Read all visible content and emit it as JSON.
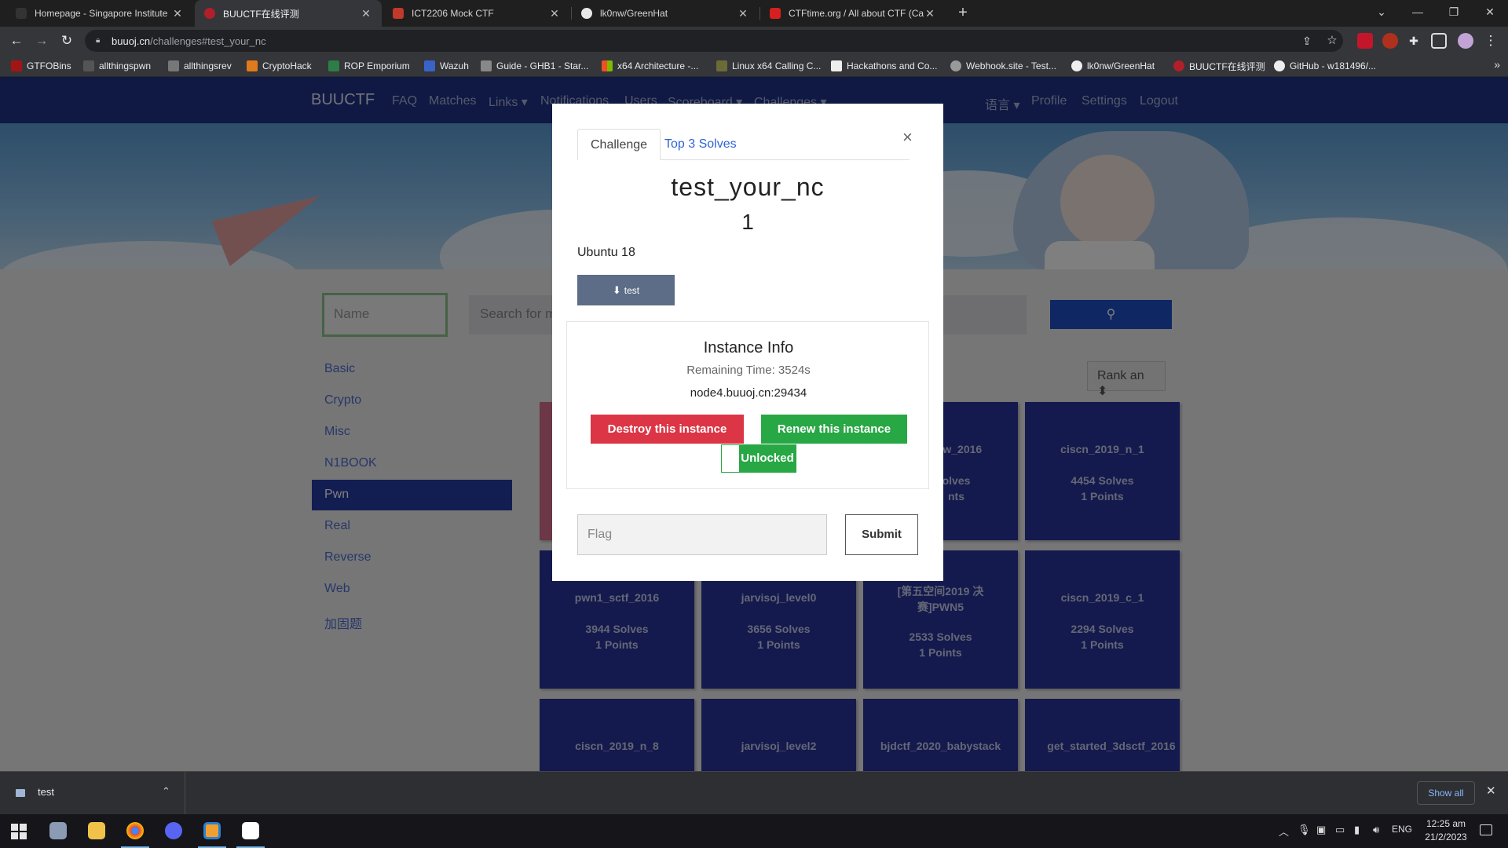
{
  "browser": {
    "tabs": [
      {
        "label": "Homepage - Singapore Institute",
        "active": false
      },
      {
        "label": "BUUCTF在线评测",
        "active": true
      },
      {
        "label": "ICT2206 Mock CTF",
        "active": false
      },
      {
        "label": "lk0nw/GreenHat",
        "active": false
      },
      {
        "label": "CTFtime.org / All about CTF (Cap",
        "active": false
      }
    ],
    "url_host": "buuoj.cn",
    "url_path": "/challenges#test_your_nc",
    "bookmarks": [
      "GTFOBins",
      "allthingspwn",
      "allthingsrev",
      "CryptoHack",
      "ROP Emporium",
      "Wazuh",
      "Guide - GHB1 - Star...",
      "x64 Architecture -...",
      "Linux x64 Calling C...",
      "Hackathons and Co...",
      "Webhook.site - Test...",
      "lk0nw/GreenHat",
      "BUUCTF在线评测",
      "GitHub - w181496/..."
    ],
    "bookmarks_more": "»"
  },
  "site": {
    "brand": "BUUCTF",
    "nav_left": [
      "FAQ",
      "Matches",
      "Links ▾",
      "Notifications",
      "Users",
      "Scoreboard ▾",
      "Challenges ▾"
    ],
    "nav_right": [
      "语言 ▾",
      "Profile",
      "Settings",
      "Logout"
    ],
    "name_placeholder": "Name",
    "search_placeholder": "Search for m",
    "categories": [
      "Basic",
      "Crypto",
      "Misc",
      "N1BOOK",
      "Pwn",
      "Real",
      "Reverse",
      "Web",
      "加固题"
    ],
    "active_category": "Pwn",
    "rank_select": "Rank an ⬍",
    "cards": [
      {
        "name": "saw_2016",
        "solves": "olves",
        "points": "nts"
      },
      {
        "name": "ciscn_2019_n_1",
        "solves": "4454 Solves",
        "points": "1 Points"
      },
      {
        "name": "pwn1_sctf_2016",
        "solves": "3944 Solves",
        "points": "1 Points"
      },
      {
        "name": "jarvisoj_level0",
        "solves": "3656 Solves",
        "points": "1 Points"
      },
      {
        "name": "[第五空间2019 决赛]PWN5",
        "solves": "2533 Solves",
        "points": "1 Points"
      },
      {
        "name": "ciscn_2019_c_1",
        "solves": "2294 Solves",
        "points": "1 Points"
      },
      {
        "name": "ciscn_2019_n_8",
        "solves": "",
        "points": ""
      },
      {
        "name": "jarvisoj_level2",
        "solves": "",
        "points": ""
      },
      {
        "name": "bjdctf_2020_babystack",
        "solves": "",
        "points": ""
      },
      {
        "name": "get_started_3dsctf_2016",
        "solves": "",
        "points": ""
      }
    ]
  },
  "modal": {
    "tabs": [
      "Challenge",
      "Top 3 Solves"
    ],
    "close": "×",
    "title": "test_your_nc",
    "value": "1",
    "description": "Ubuntu 18",
    "download_label": "test",
    "instance": {
      "title": "Instance Info",
      "remaining": "Remaining Time: 3524s",
      "host": "node4.buuoj.cn:29434",
      "destroy_label": "Destroy this instance",
      "renew_label": "Renew this instance",
      "unlocked_label": "Unlocked"
    },
    "flag_placeholder": "Flag",
    "submit_label": "Submit"
  },
  "downloads": {
    "file": "test",
    "show_all": "Show all",
    "close": "✕"
  },
  "taskbar": {
    "lang": "ENG",
    "time": "12:25 am",
    "date": "21/2/2023"
  },
  "colors": {
    "nav_bg": "#1f3388",
    "card_bg": "#28359a",
    "danger": "#dc3545",
    "success": "#28a745",
    "link": "#2f63d6"
  }
}
